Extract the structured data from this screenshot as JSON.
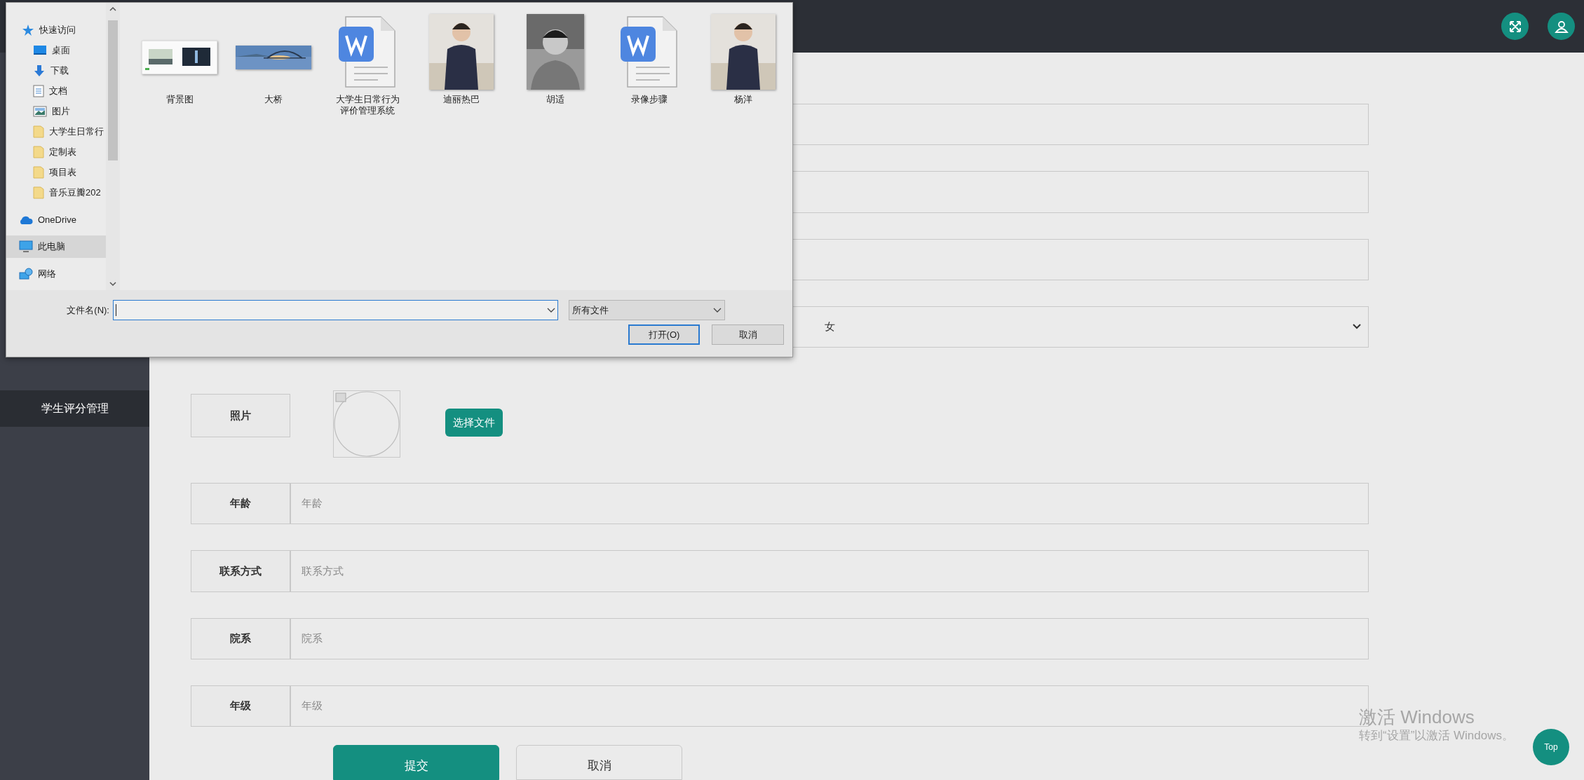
{
  "header": {
    "buttons": [
      {
        "kind": "fullscreen"
      },
      {
        "kind": "user"
      }
    ]
  },
  "sidebar": {
    "items": [
      {
        "label": "学生评分管理",
        "selected": true
      }
    ]
  },
  "form": {
    "fields": [
      {
        "kind": "text"
      },
      {
        "kind": "text"
      },
      {
        "kind": "text"
      },
      {
        "kind": "select",
        "value": "女"
      },
      {
        "label": "照片",
        "button": "选择文件"
      },
      {
        "kind": "text",
        "label": "年龄",
        "placeholder": "年龄"
      },
      {
        "kind": "text",
        "label": "联系方式",
        "placeholder": "联系方式"
      },
      {
        "kind": "text",
        "label": "院系",
        "placeholder": "院系"
      },
      {
        "kind": "text",
        "label": "年级",
        "placeholder": "年级"
      }
    ],
    "buttons": [
      {
        "label": "提交",
        "kind": "primary"
      },
      {
        "label": "取消",
        "kind": "plain"
      }
    ]
  },
  "dialog": {
    "nav": [
      {
        "label": "快速访问",
        "kind": "star",
        "selected": false
      },
      {
        "label": "桌面",
        "kind": "desktop",
        "selected": false
      },
      {
        "label": "下载",
        "kind": "download",
        "selected": false
      },
      {
        "label": "文档",
        "kind": "document",
        "selected": false
      },
      {
        "label": "图片",
        "kind": "pictures",
        "selected": false
      },
      {
        "label": "大学生日常行",
        "kind": "folder",
        "selected": false
      },
      {
        "label": "定制表",
        "kind": "folder",
        "selected": false
      },
      {
        "label": "项目表",
        "kind": "folder",
        "selected": false
      },
      {
        "label": "音乐豆瓣202",
        "kind": "folder",
        "selected": false
      },
      {
        "label": "OneDrive",
        "kind": "cloud",
        "selected": false
      },
      {
        "label": "此电脑",
        "kind": "computer",
        "selected": true
      },
      {
        "label": "网络",
        "kind": "network",
        "selected": false
      }
    ],
    "files": [
      {
        "name": "背景图",
        "kind": "screens"
      },
      {
        "name": "大桥",
        "kind": "bridge"
      },
      {
        "name": "大学生日常行为评价管理系统",
        "kind": "doc"
      },
      {
        "name": "迪丽热巴",
        "kind": "person"
      },
      {
        "name": "胡适",
        "kind": "portrait"
      },
      {
        "name": "录像步骤",
        "kind": "doc"
      },
      {
        "name": "杨洋",
        "kind": "person"
      }
    ],
    "filename_label": "文件名(N):",
    "file_type": "所有文件",
    "open_button": "打开(O)",
    "cancel_button": "取消"
  },
  "activation": {
    "title": "激活 Windows",
    "text": "转到“设置”以激活 Windows。"
  },
  "top_button": "Top"
}
